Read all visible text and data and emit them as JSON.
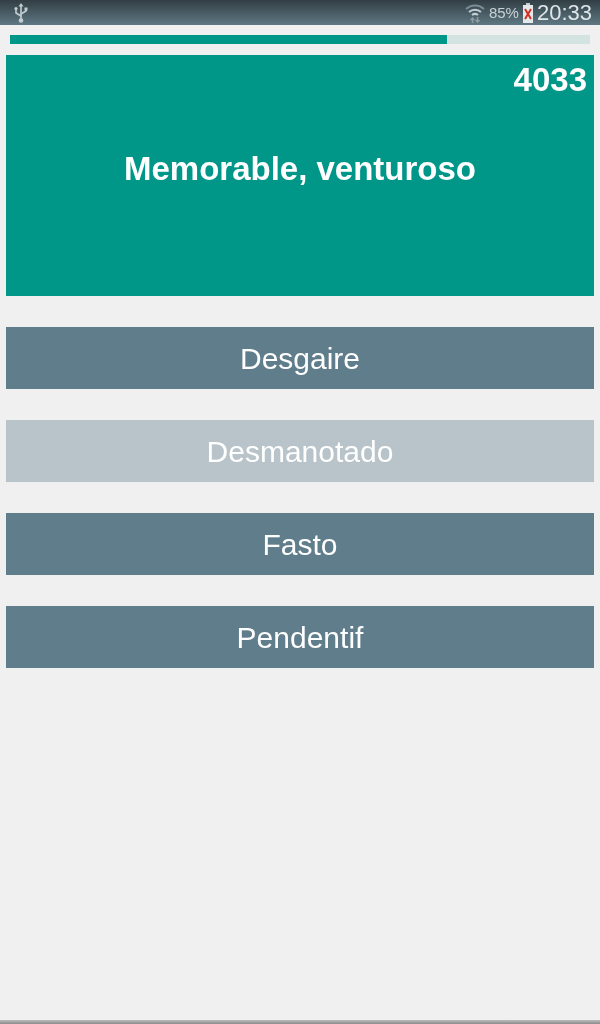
{
  "status_bar": {
    "battery_percent": "85%",
    "time": "20:33"
  },
  "progress": {
    "level": 0.753
  },
  "question": {
    "score": "4033",
    "text": "Memorable, venturoso"
  },
  "answers": [
    {
      "label": "Desgaire",
      "disabled": false
    },
    {
      "label": "Desmanotado",
      "disabled": true
    },
    {
      "label": "Fasto",
      "disabled": false
    },
    {
      "label": "Pendentif",
      "disabled": false
    }
  ]
}
